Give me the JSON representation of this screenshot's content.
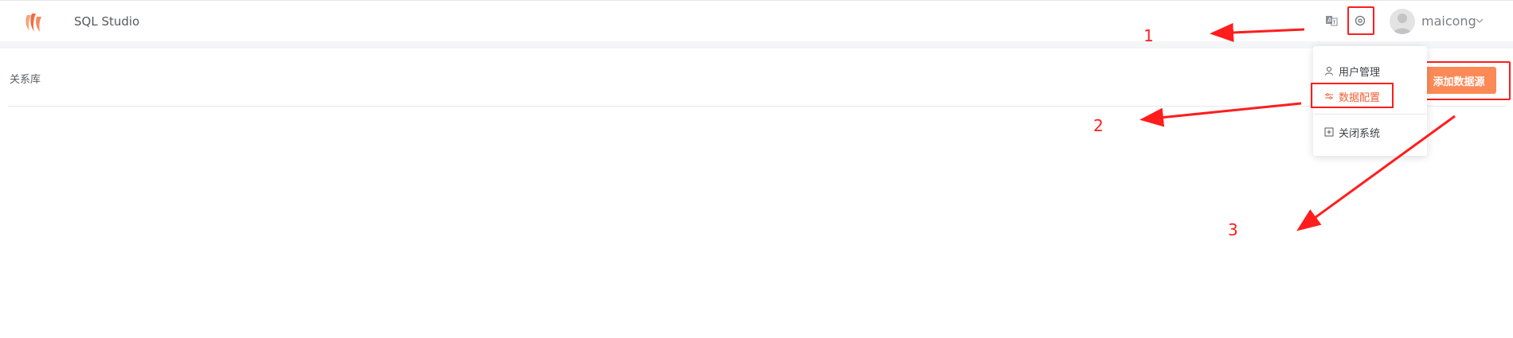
{
  "app": {
    "title": "SQL Studio"
  },
  "header": {
    "username": "maicong",
    "icons": [
      "translate-icon",
      "settings-icon",
      "avatar",
      "chevron-down-icon"
    ]
  },
  "main": {
    "tab_label": "关系库",
    "add_button_label": "添加数据源"
  },
  "settings_menu": {
    "items": [
      {
        "label": "用户管理",
        "icon": "user-icon"
      },
      {
        "label": "数据配置",
        "icon": "sliders-icon",
        "active": true
      },
      {
        "label": "关闭系统",
        "icon": "close-square-icon"
      }
    ]
  },
  "annotations": {
    "steps": [
      "1",
      "2",
      "3"
    ],
    "color": "#ff1d1d"
  },
  "colors": {
    "accent": "#fc8a57",
    "active_menu": "#f45f35",
    "logo": "#f26a3d"
  }
}
